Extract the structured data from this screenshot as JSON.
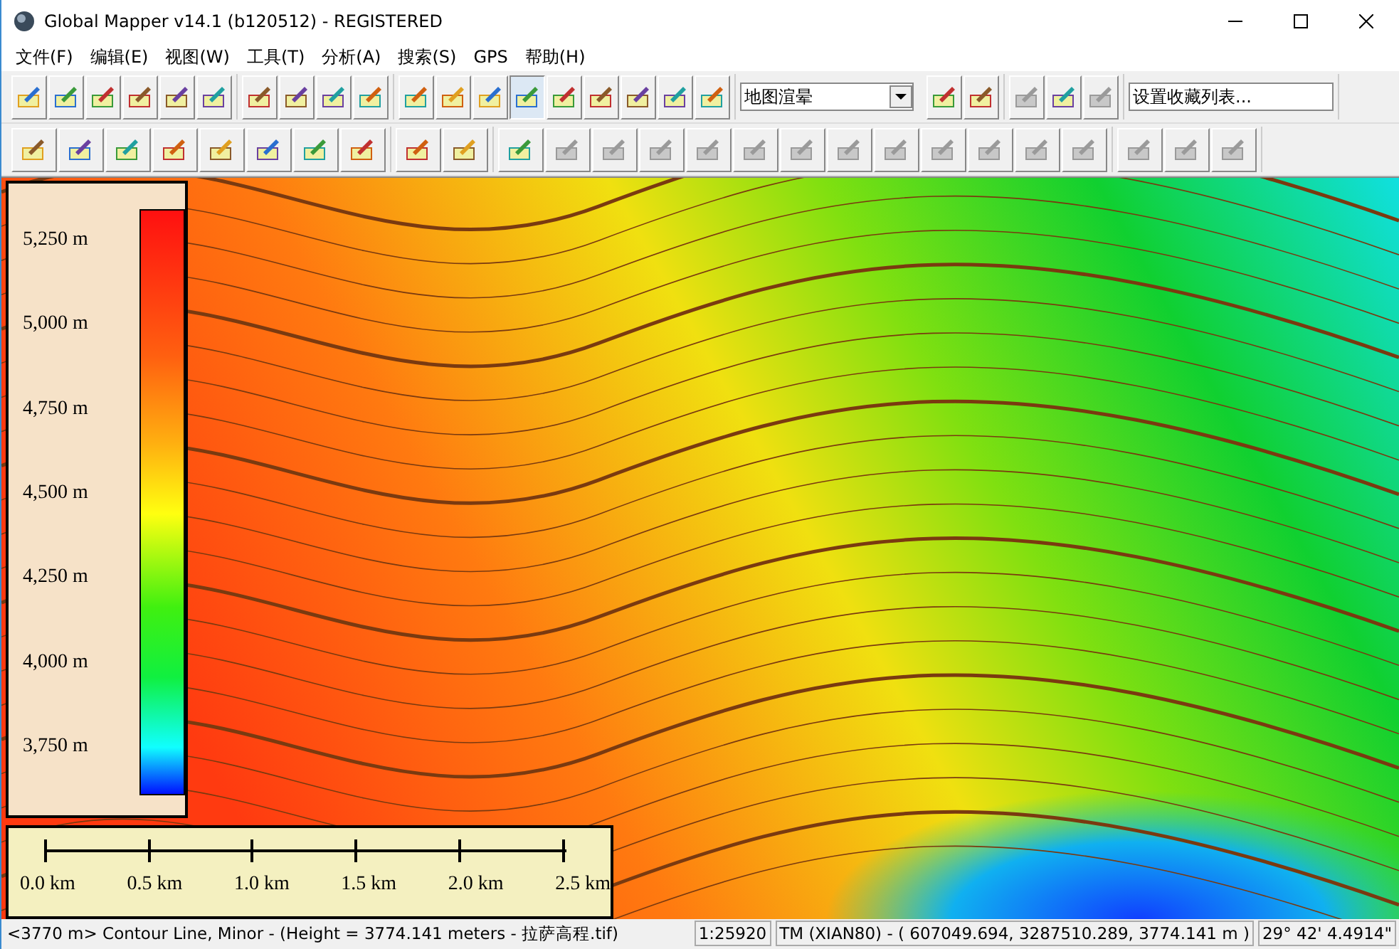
{
  "window": {
    "title": "Global Mapper v14.1 (b120512) - REGISTERED"
  },
  "menu": [
    {
      "label": "文件(F)"
    },
    {
      "label": "编辑(E)"
    },
    {
      "label": "视图(W)"
    },
    {
      "label": "工具(T)"
    },
    {
      "label": "分析(A)"
    },
    {
      "label": "搜索(S)"
    },
    {
      "label": "GPS"
    },
    {
      "label": "帮助(H)"
    }
  ],
  "toolbars": [
    {
      "groups": [
        {
          "items": [
            {
              "kind": "button",
              "disabled": false,
              "selected": false
            },
            {
              "kind": "button",
              "disabled": false,
              "selected": false
            },
            {
              "kind": "button",
              "disabled": false,
              "selected": false
            },
            {
              "kind": "button",
              "disabled": false,
              "selected": false
            },
            {
              "kind": "button",
              "disabled": false,
              "selected": false
            },
            {
              "kind": "button",
              "disabled": false,
              "selected": false
            }
          ]
        },
        {
          "items": [
            {
              "kind": "button",
              "disabled": false,
              "selected": false
            },
            {
              "kind": "button",
              "disabled": false,
              "selected": false
            },
            {
              "kind": "button",
              "disabled": false,
              "selected": false
            },
            {
              "kind": "button",
              "disabled": false,
              "selected": false
            }
          ]
        },
        {
          "items": [
            {
              "kind": "button",
              "disabled": false,
              "selected": false
            },
            {
              "kind": "button",
              "disabled": false,
              "selected": false
            },
            {
              "kind": "button",
              "disabled": false,
              "selected": false
            },
            {
              "kind": "button",
              "disabled": false,
              "selected": true
            },
            {
              "kind": "button",
              "disabled": false,
              "selected": false
            },
            {
              "kind": "button",
              "disabled": false,
              "selected": false
            },
            {
              "kind": "button",
              "disabled": false,
              "selected": false
            },
            {
              "kind": "button",
              "disabled": false,
              "selected": false
            },
            {
              "kind": "button",
              "disabled": false,
              "selected": false
            }
          ]
        },
        {
          "items": [
            {
              "kind": "dropdown",
              "value": "地图渲晕"
            },
            {
              "kind": "button",
              "disabled": false,
              "selected": false
            },
            {
              "kind": "button",
              "disabled": false,
              "selected": false
            }
          ]
        },
        {
          "items": [
            {
              "kind": "button",
              "disabled": true,
              "selected": false
            },
            {
              "kind": "button",
              "disabled": false,
              "selected": false
            },
            {
              "kind": "button",
              "disabled": true,
              "selected": false
            }
          ]
        },
        {
          "items": [
            {
              "kind": "field",
              "value": "设置收藏列表..."
            }
          ]
        }
      ]
    },
    {
      "groups": [
        {
          "items": [
            {
              "kind": "button",
              "disabled": false,
              "selected": false
            },
            {
              "kind": "button",
              "disabled": false,
              "selected": false
            },
            {
              "kind": "button",
              "disabled": false,
              "selected": false
            },
            {
              "kind": "button",
              "disabled": false,
              "selected": false
            },
            {
              "kind": "button",
              "disabled": false,
              "selected": false
            },
            {
              "kind": "button",
              "disabled": false,
              "selected": false
            },
            {
              "kind": "button",
              "disabled": false,
              "selected": false
            },
            {
              "kind": "button",
              "disabled": false,
              "selected": false
            }
          ]
        },
        {
          "items": [
            {
              "kind": "button",
              "disabled": false,
              "selected": false
            },
            {
              "kind": "button",
              "disabled": false,
              "selected": false
            }
          ]
        },
        {
          "items": [
            {
              "kind": "button",
              "disabled": false,
              "selected": false
            },
            {
              "kind": "button",
              "disabled": true,
              "selected": false
            },
            {
              "kind": "button",
              "disabled": true,
              "selected": false
            },
            {
              "kind": "button",
              "disabled": true,
              "selected": false
            },
            {
              "kind": "button",
              "disabled": true,
              "selected": false
            },
            {
              "kind": "button",
              "disabled": true,
              "selected": false
            },
            {
              "kind": "button",
              "disabled": true,
              "selected": false
            },
            {
              "kind": "button",
              "disabled": true,
              "selected": false
            },
            {
              "kind": "button",
              "disabled": true,
              "selected": false
            },
            {
              "kind": "button",
              "disabled": true,
              "selected": false
            },
            {
              "kind": "button",
              "disabled": true,
              "selected": false
            },
            {
              "kind": "button",
              "disabled": true,
              "selected": false
            },
            {
              "kind": "button",
              "disabled": true,
              "selected": false
            }
          ]
        },
        {
          "items": [
            {
              "kind": "button",
              "disabled": true,
              "selected": false
            },
            {
              "kind": "button",
              "disabled": true,
              "selected": false
            },
            {
              "kind": "button",
              "disabled": true,
              "selected": false
            }
          ]
        }
      ]
    }
  ],
  "legend": {
    "labels": [
      "5,250 m",
      "5,000 m",
      "4,750 m",
      "4,500 m",
      "4,250 m",
      "4,000 m",
      "3,750 m"
    ]
  },
  "scale_bar": {
    "labels": [
      "0.0 km",
      "0.5 km",
      "1.0 km",
      "1.5 km",
      "2.0 km",
      "2.5 km"
    ]
  },
  "status_bar": {
    "message": "<3770 m> Contour Line, Minor - (Height = 3774.141 meters - 拉萨高程.tif)",
    "scale": "1:25920",
    "coordinates": "TM (XIAN80) - ( 607049.694, 3287510.289, 3774.141 m )",
    "latitude": "29° 42' 4.4914\""
  }
}
